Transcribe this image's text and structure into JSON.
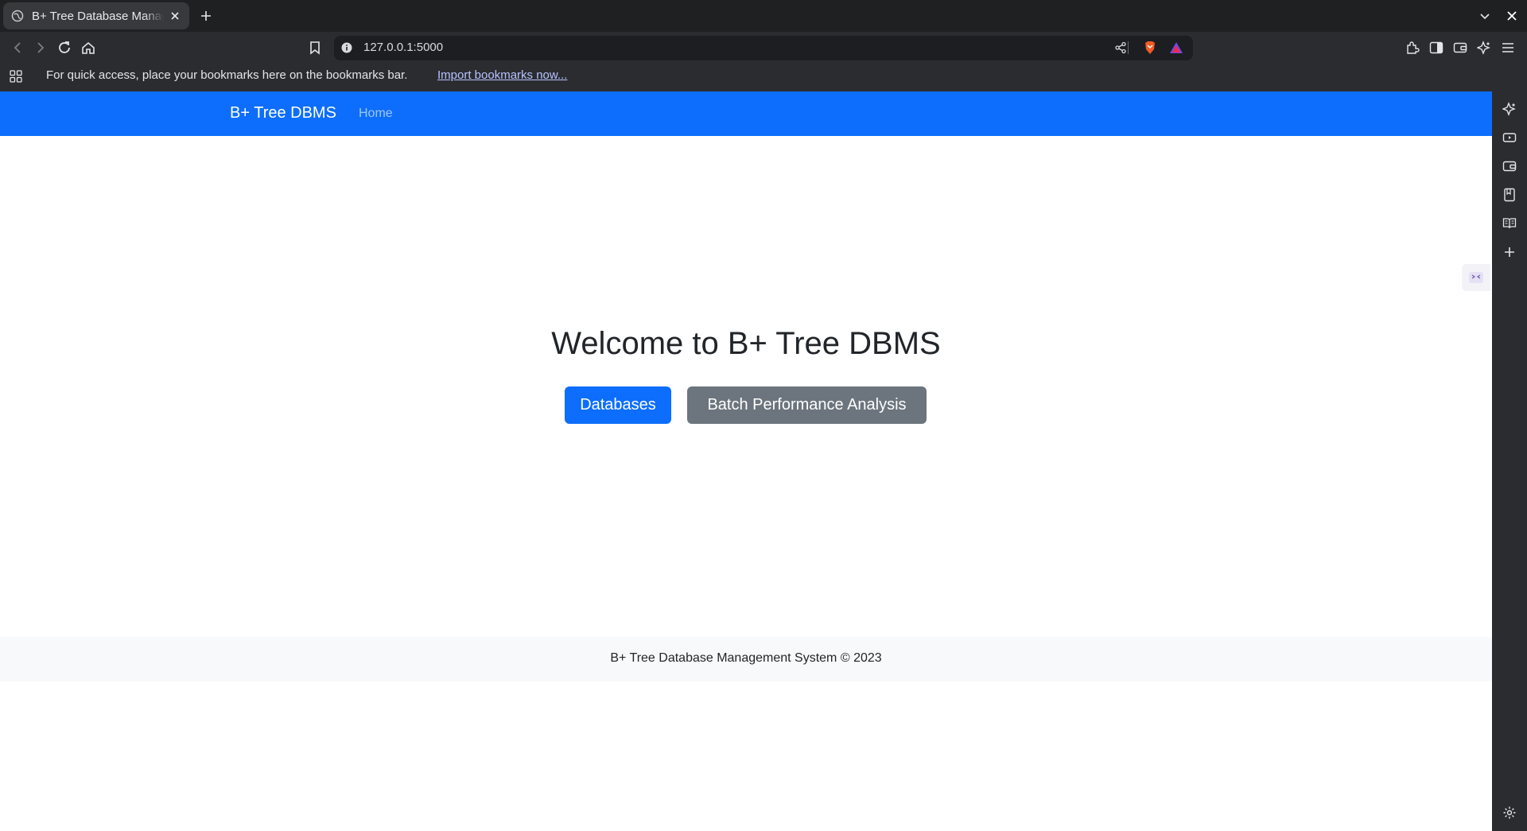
{
  "browser": {
    "tab_title": "B+ Tree Database Management System",
    "url": "127.0.0.1:5000",
    "bookmarks_hint": "For quick access, place your bookmarks here on the bookmarks bar.",
    "import_bookmarks_link": "Import bookmarks now..."
  },
  "navbar": {
    "brand": "B+ Tree DBMS",
    "links": [
      "Home"
    ],
    "color": "#0d6efd"
  },
  "main": {
    "heading": "Welcome to B+ Tree DBMS",
    "buttons": {
      "primary": "Databases",
      "secondary": "Batch Performance Analysis"
    }
  },
  "footer": {
    "text": "B+ Tree Database Management System © 2023"
  },
  "icons": {
    "toolbar": [
      "back-icon",
      "forward-icon",
      "reload-icon",
      "home-icon",
      "bookmark-icon",
      "site-info-icon",
      "share-icon",
      "brave-shields-icon",
      "brave-rewards-icon",
      "extensions-icon",
      "sidebar-toggle-icon",
      "wallet-icon",
      "leo-ai-icon",
      "menu-icon"
    ],
    "sidebar": [
      "leo-ai-icon",
      "video-icon",
      "wallet-icon",
      "bookmarks-icon",
      "reading-list-icon",
      "add-icon",
      "settings-icon"
    ]
  }
}
